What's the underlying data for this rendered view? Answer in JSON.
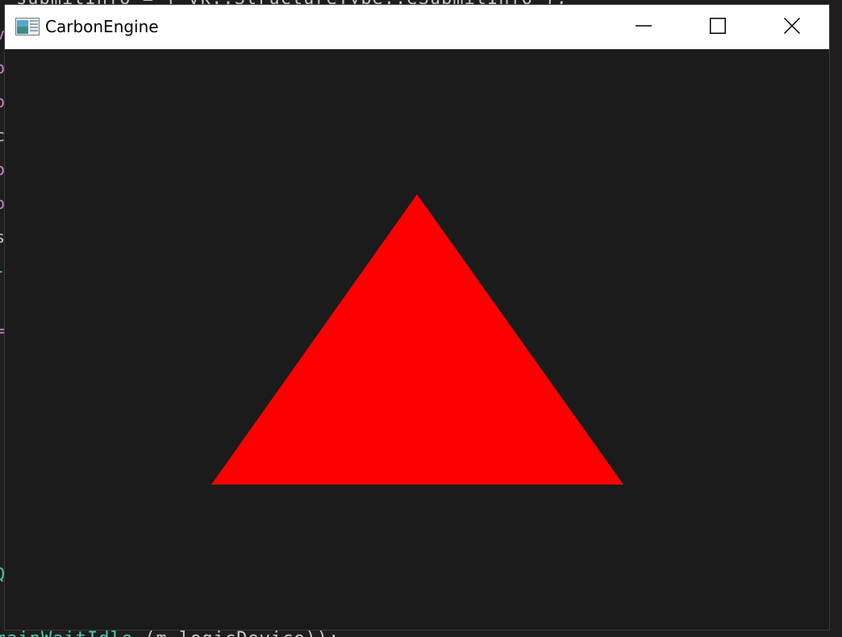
{
  "window": {
    "title": "CarbonEngine",
    "icon": "application-window-icon",
    "controls": [
      "minimize-icon",
      "maximize-icon",
      "close-icon"
    ]
  },
  "background_code": {
    "top_line": "submitInfo = { vk::StructureType::eSubmitInfo };",
    "bottom_line_part1": "mainWaitIdle",
    "bottom_line_part2": "(m_logicDevice));"
  },
  "scene": {
    "clear_color": "#1b1b1b",
    "triangle_color": "#ff0000",
    "shape": "triangle"
  }
}
